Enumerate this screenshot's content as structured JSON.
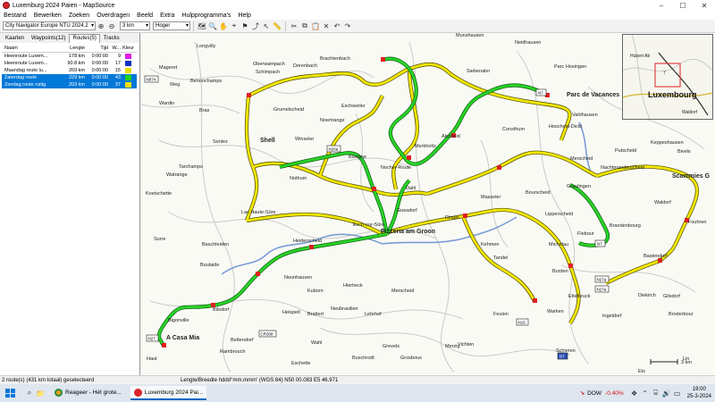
{
  "window": {
    "title": "Luxemburg 2024 Paien - MapSource",
    "minimize": "–",
    "maximize": "☐",
    "close": "✕"
  },
  "menu": [
    "Bestand",
    "Bewerken",
    "Zoeken",
    "Overdragen",
    "Beeld",
    "Extra",
    "Hulpprogramma's",
    "Help"
  ],
  "toolbar": {
    "map_product": "City Navigator Europe NTU 2024.2",
    "scale": "3 km",
    "detail": "Hoger"
  },
  "tabs": [
    "Kaarten",
    "Waypoints(12)",
    "Routes(5)",
    "Tracks"
  ],
  "routes_table": {
    "headers": {
      "name": "Naam",
      "length": "Lengte",
      "time": "Tijd",
      "wp": "W...",
      "color": "Kleur"
    },
    "rows": [
      {
        "name": "Heenroute Luxem...",
        "length": "178 km",
        "time": "0:00:00",
        "wp": "9",
        "color": "#e020e0",
        "selected": false
      },
      {
        "name": "Heenroute Luxem...",
        "length": "90.8 km",
        "time": "0:00:00",
        "wp": "17",
        "color": "#1030c0",
        "selected": false
      },
      {
        "name": "Maandag route lu...",
        "length": "269 km",
        "time": "0:00:00",
        "wp": "15",
        "color": "#e8e000",
        "selected": false
      },
      {
        "name": "Zaterdag route",
        "length": "229 km",
        "time": "0:00:00",
        "wp": "43",
        "color": "#20d020",
        "selected": true
      },
      {
        "name": "Zondag route ruitig",
        "length": "203 km",
        "time": "0:00:00",
        "wp": "37",
        "color": "#f0e000",
        "selected": true
      }
    ]
  },
  "map": {
    "places": [
      {
        "id": "longvilly",
        "label": "Longvilly"
      },
      {
        "id": "brachtenbach",
        "label": "Brachtenbach"
      },
      {
        "id": "munshausen",
        "label": "Munshausen"
      },
      {
        "id": "neidhausen",
        "label": "Neidhausen"
      },
      {
        "id": "mageret",
        "label": "Mageret"
      },
      {
        "id": "oberwampach",
        "label": "Oberwampach"
      },
      {
        "id": "derenbach",
        "label": "Derenbach"
      },
      {
        "id": "schimpach",
        "label": "Schimpach"
      },
      {
        "id": "benonchamps",
        "label": "Benonchamps"
      },
      {
        "id": "siebenaler",
        "label": "Siebenaler"
      },
      {
        "id": "parc-hosingen",
        "label": "Parc Hosingen"
      },
      {
        "id": "weg",
        "label": "Weg"
      },
      {
        "id": "wardin",
        "label": "Wardin"
      },
      {
        "id": "bras",
        "label": "Bras"
      },
      {
        "id": "grumelscheid",
        "label": "Grumelscheid"
      },
      {
        "id": "eschweiler",
        "label": "Eschweiler"
      },
      {
        "id": "parc-de-vacances",
        "label": "Parc de Vacances"
      },
      {
        "id": "vahlhausen",
        "label": "Vahlhausen"
      },
      {
        "id": "hoscheid-dickt",
        "label": "Hoscheid-Dickt"
      },
      {
        "id": "noertrange",
        "label": "Noertrange"
      },
      {
        "id": "alscheid",
        "label": "Alscheid"
      },
      {
        "id": "consthum",
        "label": "Consthum"
      },
      {
        "id": "sonlez",
        "label": "Sonlez"
      },
      {
        "id": "shell",
        "label": "Shell"
      },
      {
        "id": "winseler",
        "label": "Winseler"
      },
      {
        "id": "merkholtz",
        "label": "Merkholtz"
      },
      {
        "id": "putscheid",
        "label": "Putscheid"
      },
      {
        "id": "keppeshausen",
        "label": "Keppeshausen"
      },
      {
        "id": "bivels",
        "label": "Bivels"
      },
      {
        "id": "merscheid",
        "label": "Merscheid"
      },
      {
        "id": "nachtmanderscheid",
        "label": "Nachtmanderscheid"
      },
      {
        "id": "bavigne",
        "label": "Bavigne"
      },
      {
        "id": "nocher-route",
        "label": "Nocher-Route"
      },
      {
        "id": "tarchamps",
        "label": "Tarchamps"
      },
      {
        "id": "watrange",
        "label": "Watrange"
      },
      {
        "id": "nothum",
        "label": "Nothum"
      },
      {
        "id": "scammies",
        "label": "Scammies G"
      },
      {
        "id": "dahl",
        "label": "Dahl"
      },
      {
        "id": "masseler",
        "label": "Masseler"
      },
      {
        "id": "bourscheid",
        "label": "Bourscheid"
      },
      {
        "id": "graulingen",
        "label": "Graulingen"
      },
      {
        "id": "sac-haute-sure",
        "label": "Lac Haute-Sûre"
      },
      {
        "id": "goesdorf",
        "label": "Goesdorf"
      },
      {
        "id": "waldorf",
        "label": "Waldorf"
      },
      {
        "id": "fouhren",
        "label": "Fouhren"
      },
      {
        "id": "esch-sur-sure",
        "label": "Esch-sur-Sûre"
      },
      {
        "id": "pizzeria-am-groon",
        "label": "Pizzeria am Groon"
      },
      {
        "id": "ringel",
        "label": "Ringel"
      },
      {
        "id": "lipperscheid",
        "label": "Lipperscheid"
      },
      {
        "id": "brandenbourg",
        "label": "Brandenbourg"
      },
      {
        "id": "surre",
        "label": "Surre"
      },
      {
        "id": "baschleiden",
        "label": "Baschleiden"
      },
      {
        "id": "heiderscheid",
        "label": "Heiderscheid"
      },
      {
        "id": "kehmen",
        "label": "Kehmen"
      },
      {
        "id": "michelau",
        "label": "Michelau"
      },
      {
        "id": "flebour",
        "label": "Flebour"
      },
      {
        "id": "bastendorf",
        "label": "Bastendorf"
      },
      {
        "id": "boulaide",
        "label": "Boulaide"
      },
      {
        "id": "ettelbruck",
        "label": "Ettelbruck"
      },
      {
        "id": "burden",
        "label": "Burden"
      },
      {
        "id": "tandel",
        "label": "Tandel"
      },
      {
        "id": "feulen",
        "label": "Feulen"
      },
      {
        "id": "kuborn",
        "label": "Kuborn"
      },
      {
        "id": "hierheck",
        "label": "Hierheck"
      },
      {
        "id": "merscheid-s",
        "label": "Merscheid"
      },
      {
        "id": "diekirch",
        "label": "Diekirch"
      },
      {
        "id": "gilsdorf",
        "label": "Gilsdorf"
      },
      {
        "id": "bilsdorf",
        "label": "Bilsdorf"
      },
      {
        "id": "heispelt",
        "label": "Heispelt"
      },
      {
        "id": "brattert",
        "label": "Brattert"
      },
      {
        "id": "neubrasilien",
        "label": "Neubrasilien"
      },
      {
        "id": "lehrhof",
        "label": "Lehrhof"
      },
      {
        "id": "warken",
        "label": "Warken"
      },
      {
        "id": "ingeldorf",
        "label": "Ingeldorf"
      },
      {
        "id": "broderbour",
        "label": "Broderbour"
      },
      {
        "id": "bigonville",
        "label": "Bigonville"
      },
      {
        "id": "a-casa-mia",
        "label": "A Casa Mia"
      },
      {
        "id": "schieren",
        "label": "Schieren"
      },
      {
        "id": "rambrouch",
        "label": "Rambrouch"
      },
      {
        "id": "wahl",
        "label": "Wahl"
      },
      {
        "id": "grevels",
        "label": "Grevels"
      },
      {
        "id": "vichten",
        "label": "Vichten"
      },
      {
        "id": "grosbous",
        "label": "Grosbous"
      },
      {
        "id": "buschrodt",
        "label": "Buschrodt"
      },
      {
        "id": "eschette",
        "label": "Eschette"
      },
      {
        "id": "fauvillers",
        "label": "Haut"
      },
      {
        "id": "merzig",
        "label": "Merzig"
      },
      {
        "id": "lin",
        "label": "Lin"
      },
      {
        "id": "ets",
        "label": "Ets"
      },
      {
        "id": "koetschette",
        "label": "Koetschette"
      },
      {
        "id": "neunhausen",
        "label": "Neunhausen"
      },
      {
        "id": "bettendorf",
        "label": "Bettendorf"
      }
    ],
    "road_shields": [
      "N874",
      "N7",
      "N26a",
      "N7",
      "N27a",
      "N27a",
      "N15",
      "N27",
      "CR308",
      "B7"
    ],
    "overview": {
      "town_1": "Luxembourg",
      "town_2": "Hubert Ab",
      "town_3": "Waldorf",
      "scale_label": "7"
    },
    "scale_bar": "3 km"
  },
  "status": {
    "selection": "2 route(s) (431 km totaal) geselecteerd",
    "coords": "Lengte/Breedte hddd°mm.mmm' (WGS 84)   N50 00.083 E5 46.971"
  },
  "taskbar": {
    "task_1": "Reageer - Hét grote...",
    "task_2": "Luxemburg 2024 Pai...",
    "dow_label": "DOW",
    "dow_value": "-0.40%",
    "time": "19:00",
    "date": "25-3-2024"
  }
}
